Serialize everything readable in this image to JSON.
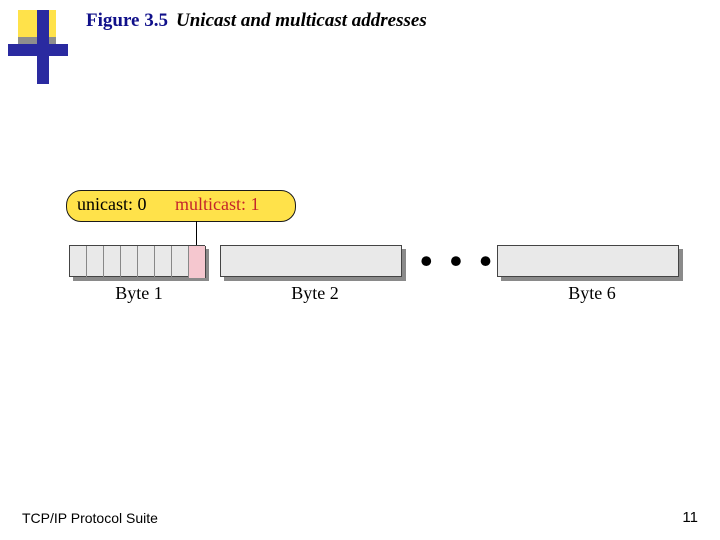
{
  "header": {
    "figure_no": "Figure 3.5",
    "figure_title": "Unicast and multicast addresses"
  },
  "callout": {
    "unicast": "unicast: 0",
    "multicast": "multicast: 1"
  },
  "bytes": {
    "b1_label": "Byte 1",
    "b2_label": "Byte 2",
    "b6_label": "Byte 6",
    "ellipsis": "• • •"
  },
  "footer": {
    "source": "TCP/IP Protocol Suite",
    "page": "11"
  }
}
